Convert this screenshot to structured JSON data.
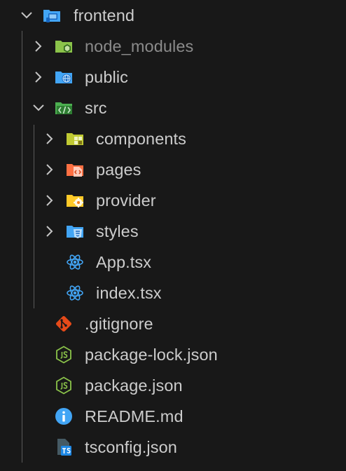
{
  "explorer": {
    "root": {
      "label": "frontend",
      "expanded": true,
      "icon": "folder-frontend-icon"
    },
    "items": [
      {
        "label": "node_modules",
        "type": "folder",
        "expanded": false,
        "icon": "folder-node-icon",
        "color": "#8bc34a"
      },
      {
        "label": "public",
        "type": "folder",
        "expanded": false,
        "icon": "folder-public-icon",
        "color": "#42a5f5"
      },
      {
        "label": "src",
        "type": "folder",
        "expanded": true,
        "icon": "folder-src-icon",
        "color": "#4caf50",
        "children": [
          {
            "label": "components",
            "type": "folder",
            "expanded": false,
            "icon": "folder-components-icon",
            "color": "#c0ca33"
          },
          {
            "label": "pages",
            "type": "folder",
            "expanded": false,
            "icon": "folder-pages-icon",
            "color": "#ff7043"
          },
          {
            "label": "provider",
            "type": "folder",
            "expanded": false,
            "icon": "folder-provider-icon",
            "color": "#ffca28"
          },
          {
            "label": "styles",
            "type": "folder",
            "expanded": false,
            "icon": "folder-styles-icon",
            "color": "#42a5f5"
          },
          {
            "label": "App.tsx",
            "type": "file",
            "icon": "react-icon",
            "color": "#42a5f5"
          },
          {
            "label": "index.tsx",
            "type": "file",
            "icon": "react-icon",
            "color": "#42a5f5"
          }
        ]
      },
      {
        "label": ".gitignore",
        "type": "file",
        "icon": "git-icon",
        "color": "#e64a19"
      },
      {
        "label": "package-lock.json",
        "type": "file",
        "icon": "nodejs-icon",
        "color": "#8bc34a"
      },
      {
        "label": "package.json",
        "type": "file",
        "icon": "nodejs-icon",
        "color": "#8bc34a"
      },
      {
        "label": "README.md",
        "type": "file",
        "icon": "info-icon",
        "color": "#42a5f5"
      },
      {
        "label": "tsconfig.json",
        "type": "file",
        "icon": "tsconfig-icon",
        "color": "#1e88e5"
      }
    ]
  }
}
